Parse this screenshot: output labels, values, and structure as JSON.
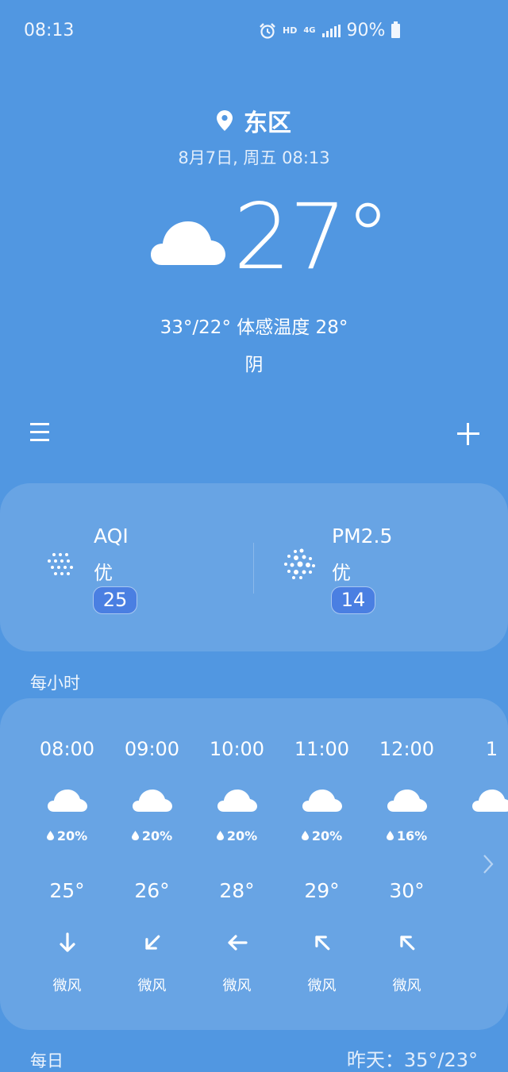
{
  "status_bar": {
    "time": "08:13",
    "hd": "HD",
    "network": "4G",
    "battery": "90%"
  },
  "location": {
    "name": "东区"
  },
  "current": {
    "date_time": "8月7日, 周五 08:13",
    "temperature": "27°",
    "range_feels": "33°/22° 体感温度 28°",
    "condition": "阴",
    "icon": "cloud-icon"
  },
  "air_quality": [
    {
      "label": "AQI",
      "level": "优",
      "value": "25",
      "icon": "dots-grid-icon"
    },
    {
      "label": "PM2.5",
      "level": "优",
      "value": "14",
      "icon": "particles-icon"
    }
  ],
  "hourly": {
    "title": "每小时",
    "items": [
      {
        "time": "08:00",
        "rain": "20%",
        "temp": "25°",
        "wind_dir": "arrow-down-icon",
        "wind": "微风"
      },
      {
        "time": "09:00",
        "rain": "20%",
        "temp": "26°",
        "wind_dir": "arrow-down-left-icon",
        "wind": "微风"
      },
      {
        "time": "10:00",
        "rain": "20%",
        "temp": "28°",
        "wind_dir": "arrow-left-icon",
        "wind": "微风"
      },
      {
        "time": "11:00",
        "rain": "20%",
        "temp": "29°",
        "wind_dir": "arrow-up-left-icon",
        "wind": "微风"
      },
      {
        "time": "12:00",
        "rain": "16%",
        "temp": "30°",
        "wind_dir": "arrow-up-left-icon",
        "wind": "微风"
      },
      {
        "time": "1",
        "rain": "",
        "temp": "",
        "wind_dir": "",
        "wind": ""
      }
    ]
  },
  "daily": {
    "title": "每日",
    "yesterday": "昨天：35°/23°"
  },
  "colors": {
    "background": "#5197e1",
    "card": "#68a4e4",
    "badge": "#4a7fe2"
  }
}
